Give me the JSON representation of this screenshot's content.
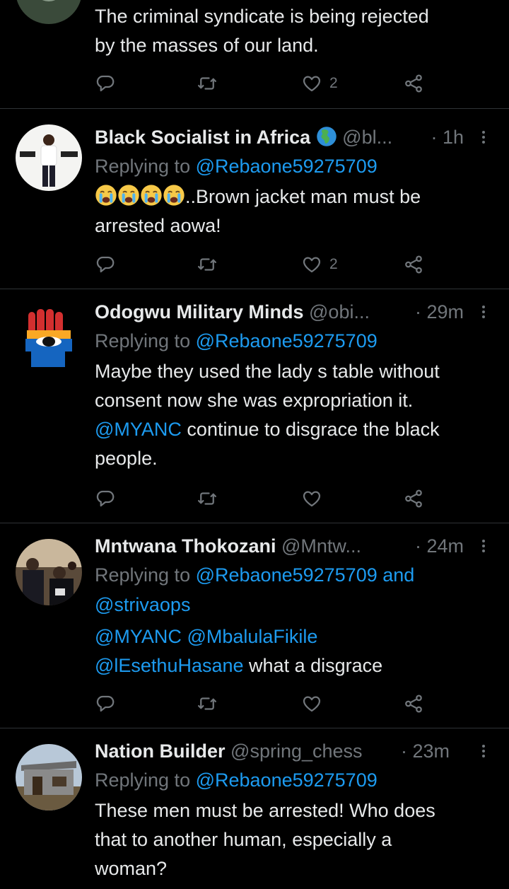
{
  "top_tweet": {
    "text_lines": [
      "The criminal syndicate is being rejected",
      "by the masses of our land."
    ],
    "like_count": "2"
  },
  "tweets": [
    {
      "name": "Black Socialist in Africa",
      "name_emoji": "globe-africa-icon",
      "handle": "@bl...",
      "time": "· 1h",
      "replying_prefix": "Replying to ",
      "replying_to": "@Rebaone59275709",
      "text_suffix": "..Brown jacket man must be",
      "text_line2": "arrested aowa!",
      "emojis": [
        "crying-face-icon",
        "crying-face-icon",
        "crying-face-icon",
        "crying-face-icon"
      ],
      "like_count": "2"
    },
    {
      "name": "Odogwu Military Minds",
      "handle": "@obi...",
      "time": "· 29m",
      "replying_prefix": "Replying to ",
      "replying_to": "@Rebaone59275709",
      "line1": "Maybe they used the lady s table without",
      "line2": "consent now she was expropriation it.",
      "mention": "@MYANC",
      "line3_rest": " continue to disgrace the black",
      "line4": "people.",
      "like_count": ""
    },
    {
      "name": "Mntwana Thokozani",
      "handle": "@Mntw...",
      "time": "· 24m",
      "replying_prefix": "Replying to ",
      "replying_to": "@Rebaone59275709",
      "and_text": " and",
      "replying_to_2": "@strivaops",
      "mention1": "@MYANC",
      "mention2": "@MbalulaFikile",
      "mention3": "@lEsethuHasane",
      "text_rest": " what a disgrace",
      "like_count": ""
    },
    {
      "name": "Nation Builder",
      "handle": "@spring_chess",
      "time": "· 23m",
      "replying_prefix": "Replying to ",
      "replying_to": "@Rebaone59275709",
      "line1": "These men must be arrested! Who does",
      "line2": "that to another human, especially a",
      "line3": "woman?"
    }
  ],
  "icons": {
    "reply": "reply-icon",
    "retweet": "retweet-icon",
    "like": "heart-icon",
    "share": "share-icon",
    "more": "more-icon"
  },
  "colors": {
    "background": "#000000",
    "text": "#e7e9ea",
    "muted": "#71767b",
    "link": "#1d9bf0",
    "divider": "#2f3336"
  }
}
